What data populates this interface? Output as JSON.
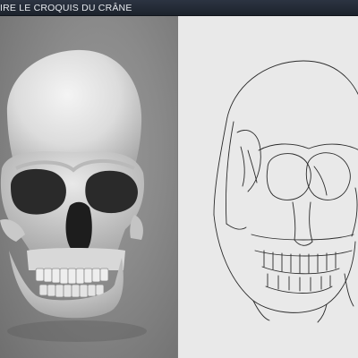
{
  "window": {
    "title": "IRE LE CROQUIS DU CRÂNE"
  },
  "panels": {
    "left": {
      "icon": "skull-render-icon"
    },
    "right": {
      "icon": "skull-sketch-icon"
    }
  },
  "colors": {
    "titlebar": "#1f2530",
    "title_text": "#e6e9ee",
    "left_background": "#8a8a8a",
    "right_background": "#e9e9e9",
    "sketch_line": "#2b2b2b"
  }
}
